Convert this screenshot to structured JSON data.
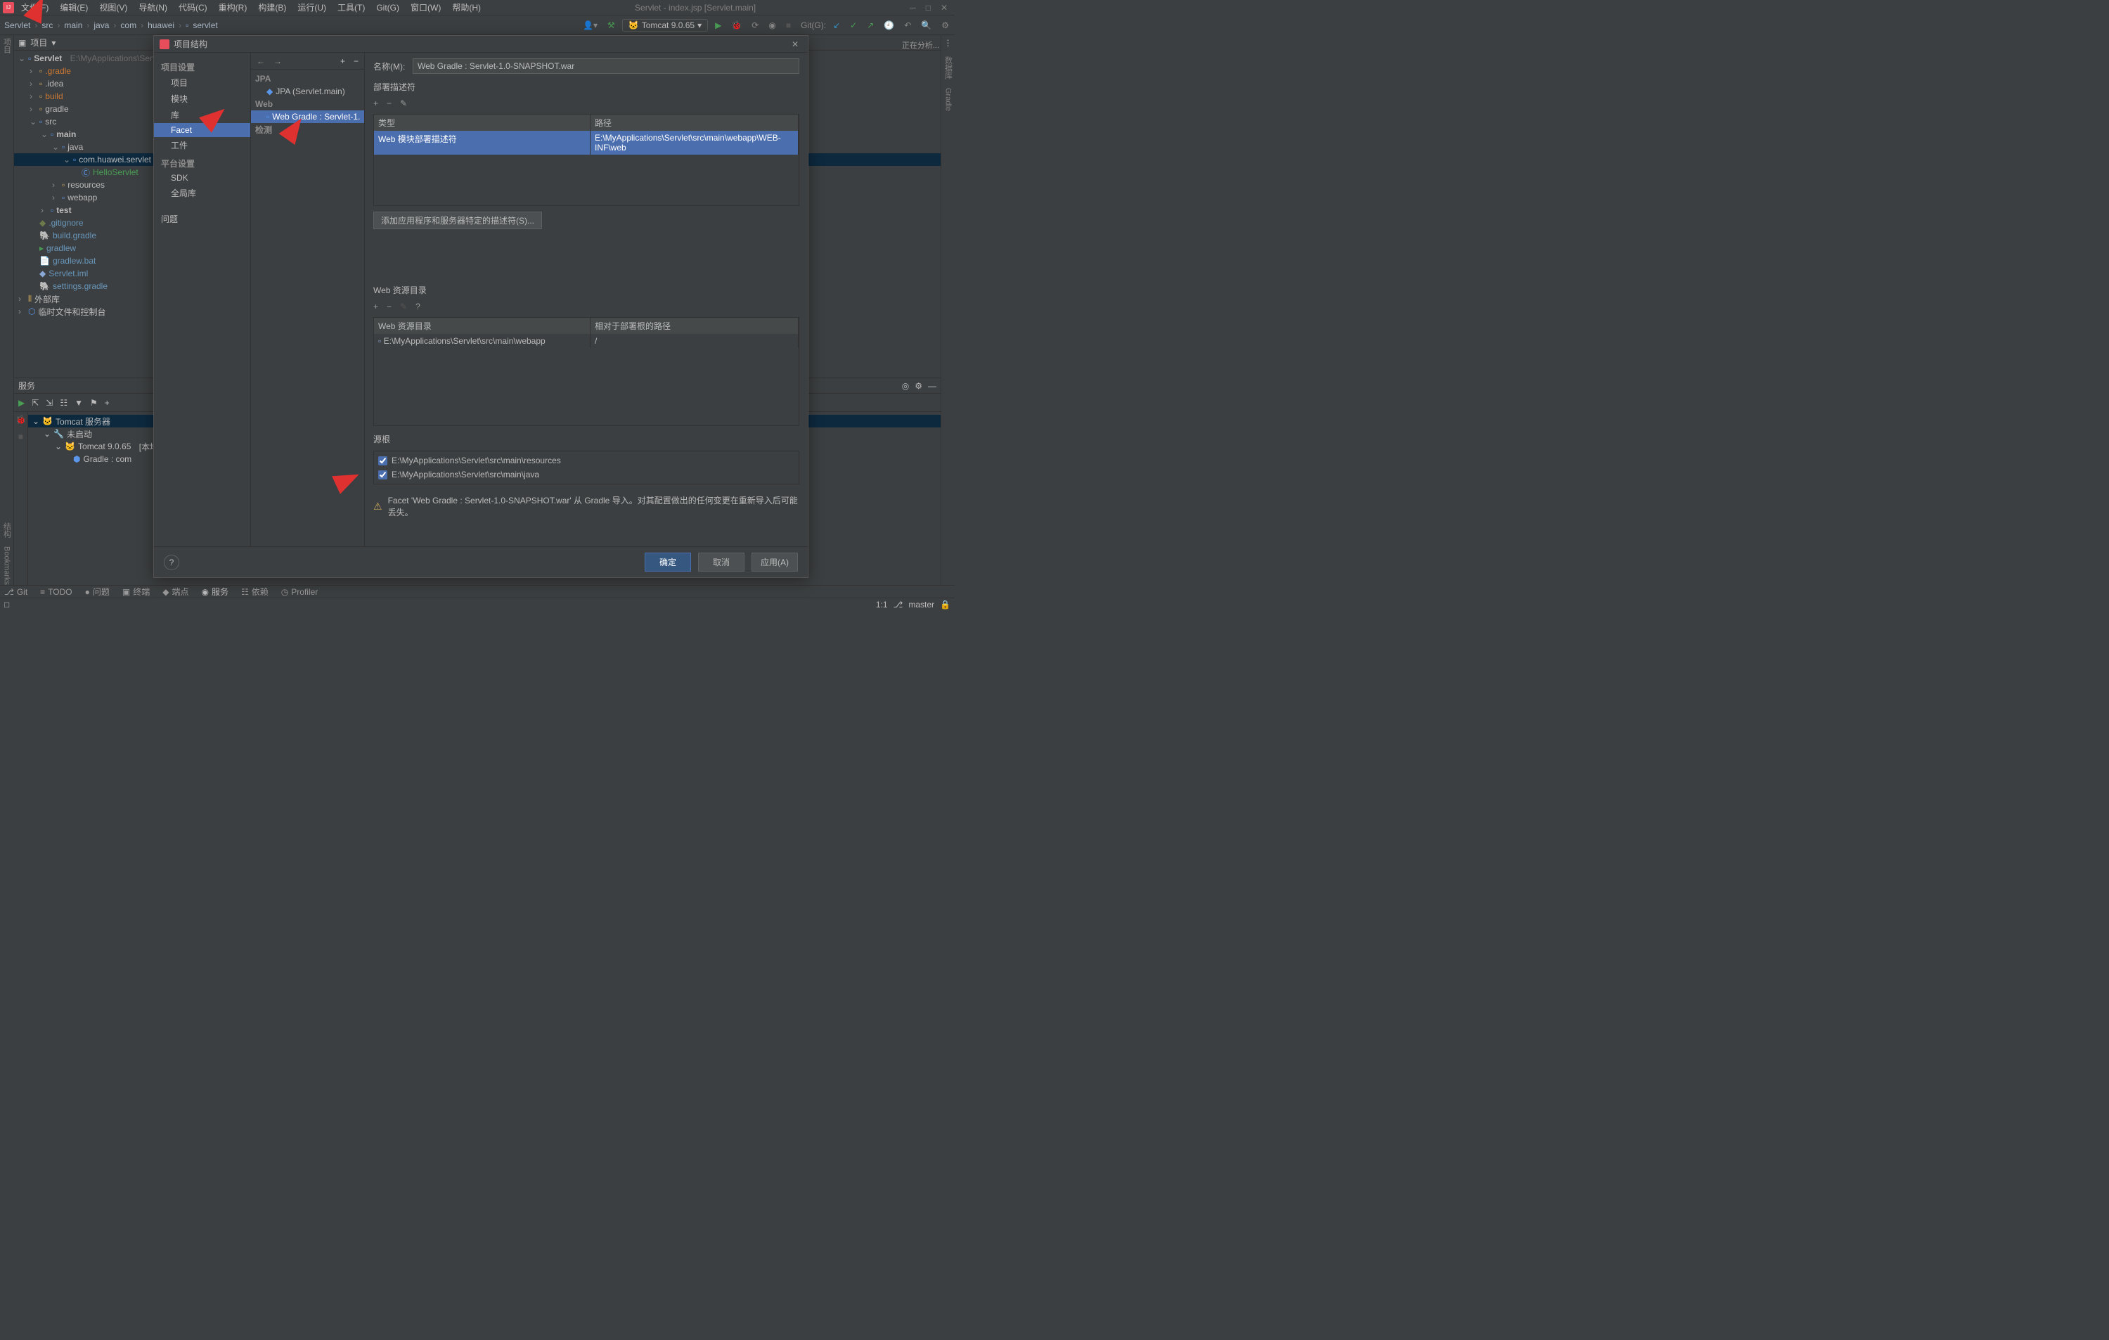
{
  "window": {
    "title": "Servlet - index.jsp [Servlet.main]"
  },
  "menu": [
    "文件(F)",
    "编辑(E)",
    "视图(V)",
    "导航(N)",
    "代码(C)",
    "重构(R)",
    "构建(B)",
    "运行(U)",
    "工具(T)",
    "Git(G)",
    "窗口(W)",
    "帮助(H)"
  ],
  "breadcrumbs": [
    "Servlet",
    "src",
    "main",
    "java",
    "com",
    "huawei",
    "servlet"
  ],
  "run_config": "Tomcat 9.0.65",
  "git_label": "Git(G):",
  "analyzing": "正在分析...",
  "project": {
    "title": "项目",
    "root": "Servlet",
    "root_path": "E:\\MyApplications\\Servlet",
    "nodes": {
      "gradle": ".gradle",
      "idea": ".idea",
      "build": "build",
      "gradle2": "gradle",
      "src": "src",
      "main": "main",
      "java": "java",
      "pkg": "com.huawei.servlet",
      "hello": "HelloServlet",
      "resources": "resources",
      "webapp": "webapp",
      "test": "test",
      "gitignore": ".gitignore",
      "buildgradle": "build.gradle",
      "gradlew": "gradlew",
      "gradlewbat": "gradlew.bat",
      "iml": "Servlet.iml",
      "settings": "settings.gradle",
      "extlib": "外部库",
      "scratch": "临时文件和控制台"
    }
  },
  "services": {
    "title": "服务",
    "tomcat_server": "Tomcat 服务器",
    "not_started": "未启动",
    "tomcat_node": "Tomcat 9.0.65",
    "tomcat_hint": "[本地]",
    "gradle_node": "Gradle : com"
  },
  "bottom_tabs": {
    "git": "Git",
    "todo": "TODO",
    "problems": "问题",
    "terminal": "终端",
    "endpoints": "端点",
    "services": "服务",
    "deps": "依赖",
    "profiler": "Profiler"
  },
  "status": {
    "pos": "1:1",
    "branch": "master"
  },
  "left_gutter": [
    "项目",
    "结构",
    "Bookmarks"
  ],
  "right_gutter": [
    "数据库",
    "Gradle"
  ],
  "dialog": {
    "title": "项目结构",
    "nav": {
      "heading1": "项目设置",
      "project": "项目",
      "modules": "模块",
      "libs": "库",
      "facet": "Facet",
      "artifacts": "工件",
      "heading2": "平台设置",
      "sdk": "SDK",
      "global": "全局库",
      "problems": "问题"
    },
    "tree": {
      "jpa": "JPA",
      "jpa_child": "JPA (Servlet.main)",
      "web": "Web",
      "web_child": "Web Gradle : Servlet-1.",
      "detection": "检测"
    },
    "name_label": "名称(M):",
    "name_value": "Web Gradle : Servlet-1.0-SNAPSHOT.war",
    "deploy_label": "部署描述符",
    "deploy_table": {
      "col1": "类型",
      "col2": "路径",
      "row1_c1": "Web 模块部署描述符",
      "row1_c2": "E:\\MyApplications\\Servlet\\src\\main\\webapp\\WEB-INF\\web"
    },
    "add_descriptor": "添加应用程序和服务器特定的描述符(S)...",
    "webres_label": "Web 资源目录",
    "webres_table": {
      "col1": "Web 资源目录",
      "col2": "相对于部署根的路径",
      "row1_c1": "E:\\MyApplications\\Servlet\\src\\main\\webapp",
      "row1_c2": "/"
    },
    "src_roots_label": "源根",
    "src_root1": "E:\\MyApplications\\Servlet\\src\\main\\resources",
    "src_root2": "E:\\MyApplications\\Servlet\\src\\main\\java",
    "warning": "Facet 'Web Gradle : Servlet-1.0-SNAPSHOT.war' 从 Gradle 导入。对其配置做出的任何变更在重新导入后可能丢失。",
    "ok": "确定",
    "cancel": "取消",
    "apply": "应用(A)"
  }
}
